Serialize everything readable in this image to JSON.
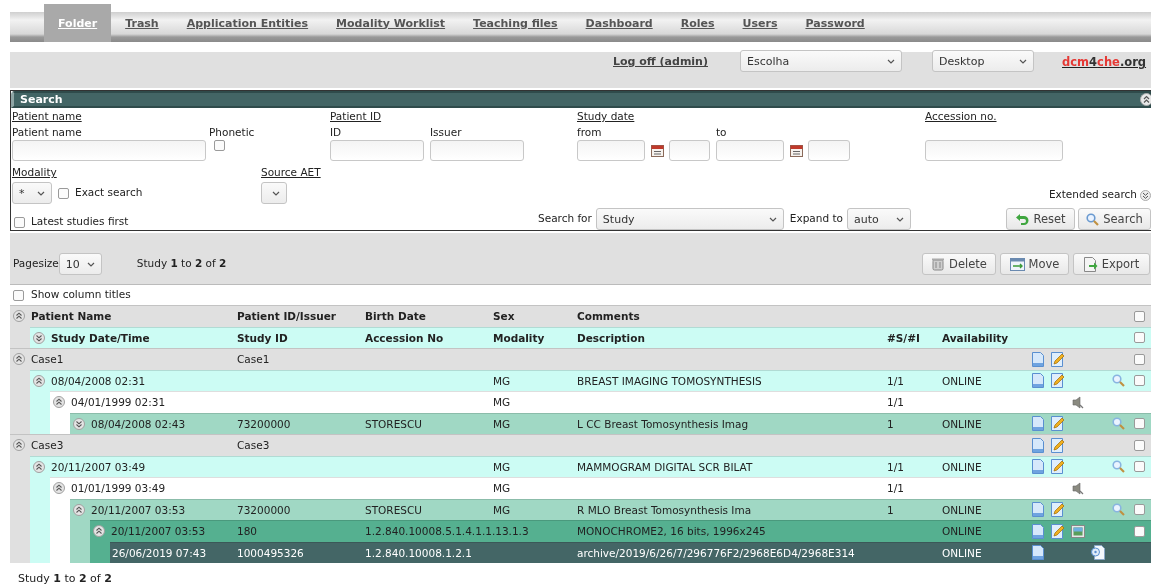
{
  "nav": {
    "tabs": [
      {
        "label": "Folder",
        "selected": true
      },
      {
        "label": "Trash",
        "selected": false
      },
      {
        "label": "Application Entities",
        "selected": false
      },
      {
        "label": "Modality Worklist",
        "selected": false
      },
      {
        "label": "Teaching files",
        "selected": false
      },
      {
        "label": "Dashboard",
        "selected": false
      },
      {
        "label": "Roles",
        "selected": false
      },
      {
        "label": "Users",
        "selected": false
      },
      {
        "label": "Password",
        "selected": false
      }
    ]
  },
  "header": {
    "logoff": "Log off (admin)",
    "selects": [
      "Escolha",
      "Desktop"
    ],
    "logo": {
      "parts": [
        {
          "text": "dcm",
          "color": "#e53935"
        },
        {
          "text": "4",
          "color": "#333333"
        },
        {
          "text": "che",
          "color": "#e53935"
        },
        {
          "text": ".org",
          "color": "#333333"
        }
      ]
    }
  },
  "search": {
    "title": "Search",
    "patient_name": {
      "heading": "Patient name",
      "label": "Patient name",
      "phonetic": {
        "label": "Phonetic",
        "checked": false
      }
    },
    "patient_id": {
      "heading": "Patient ID",
      "id_label": "ID",
      "issuer_label": "Issuer"
    },
    "study_date": {
      "heading": "Study date",
      "from_label": "from",
      "to_label": "to"
    },
    "accession": {
      "heading": "Accession no."
    },
    "modality": {
      "heading": "Modality",
      "value": "*",
      "exact_search": {
        "label": "Exact search",
        "checked": false
      }
    },
    "source_aet": {
      "heading": "Source AET"
    },
    "extended_search": "Extended search",
    "latest_first": {
      "label": "Latest studies first",
      "checked": false
    },
    "search_for": {
      "label": "Search for",
      "value": "Study"
    },
    "expand_to": {
      "label": "Expand to",
      "value": "auto"
    },
    "buttons": [
      {
        "label": "Reset",
        "kind": "reset"
      },
      {
        "label": "Search",
        "kind": "search"
      }
    ]
  },
  "results": {
    "pagesize_label": "Pagesize",
    "pagesize": "10",
    "summary": "Study **1** to **2** of **2**",
    "buttons": [
      {
        "label": "Delete",
        "kind": "delete"
      },
      {
        "label": "Move",
        "kind": "move"
      },
      {
        "label": "Export",
        "kind": "export"
      }
    ],
    "show_column_titles": {
      "label": "Show column titles",
      "checked": false
    }
  },
  "table": {
    "header_rows": [
      {
        "kind": "patient",
        "expanded": true,
        "checked": false,
        "cells": [
          "Patient Name",
          "Patient ID/Issuer",
          "Birth Date",
          "Sex",
          "Comments"
        ]
      },
      {
        "kind": "study",
        "expanded": false,
        "checked": false,
        "cells": [
          "Study Date/Time",
          "Study ID",
          "Accession No",
          "Modality",
          "Description",
          "#S/#I",
          "Availability"
        ]
      }
    ],
    "rows": [
      {
        "kind": "patient",
        "expanded": true,
        "checked": false,
        "cells": [
          "Case1",
          "Case1"
        ],
        "children": [
          {
            "kind": "study",
            "expanded": true,
            "checked": false,
            "cells": [
              "08/04/2008 02:31",
              null,
              null,
              "MG",
              "BREAST IMAGING TOMOSYNTHESIS",
              "1/1",
              "ONLINE"
            ],
            "children": [
              {
                "kind": "pps",
                "expanded": true,
                "cells": [
                  "04/01/1999 02:31",
                  null,
                  null,
                  "MG",
                  null,
                  "1/1"
                ],
                "children": [
                  {
                    "kind": "series",
                    "expanded": false,
                    "checked": false,
                    "cells": [
                      "08/04/2008 02:43",
                      "73200000",
                      "STORESCU",
                      "MG",
                      "L CC Breast Tomosynthesis Imag",
                      "1",
                      "ONLINE"
                    ]
                  }
                ]
              }
            ]
          }
        ]
      },
      {
        "kind": "patient",
        "expanded": true,
        "checked": false,
        "cells": [
          "Case3",
          "Case3"
        ],
        "children": [
          {
            "kind": "study",
            "expanded": true,
            "checked": false,
            "cells": [
              "20/11/2007 03:49",
              null,
              null,
              "MG",
              "MAMMOGRAM DIGITAL SCR BILAT",
              "1/1",
              "ONLINE"
            ],
            "children": [
              {
                "kind": "pps",
                "expanded": true,
                "cells": [
                  "01/01/1999 03:49",
                  null,
                  null,
                  "MG",
                  null,
                  "1/1"
                ],
                "children": [
                  {
                    "kind": "series",
                    "expanded": true,
                    "checked": false,
                    "cells": [
                      "20/11/2007 03:53",
                      "73200000",
                      "STORESCU",
                      "MG",
                      "R MLO Breast Tomosynthesis Ima",
                      "1",
                      "ONLINE"
                    ],
                    "children": [
                      {
                        "kind": "instance",
                        "expanded": true,
                        "checked": false,
                        "cells": [
                          "20/11/2007 03:53",
                          "180",
                          "1.2.840.10008.5.1.4.1.1.13.1.3",
                          null,
                          "MONOCHROME2, 16 bits, 1996x245",
                          null,
                          "ONLINE"
                        ],
                        "children": [
                          {
                            "kind": "file",
                            "cells": [
                              "26/06/2019 07:43",
                              "1000495326",
                              "1.2.840.10008.1.2.1",
                              null,
                              "archive/2019/6/26/7/296776F2/2968E6D4/2968E314",
                              null,
                              "ONLINE"
                            ]
                          }
                        ]
                      }
                    ]
                  }
                ]
              }
            ]
          }
        ]
      }
    ]
  },
  "footer": "Study **1** to **2** of **2**"
}
